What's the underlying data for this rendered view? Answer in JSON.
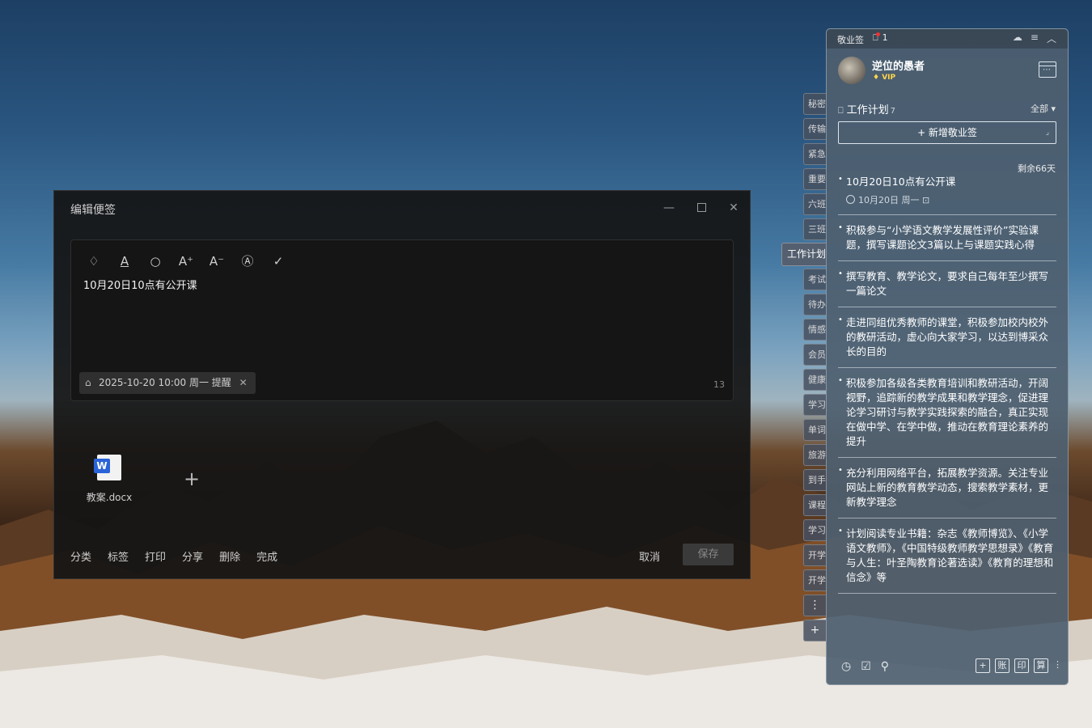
{
  "editor": {
    "title": "编辑便签",
    "win_min": "—",
    "win_close": "✕",
    "toolbar": [
      "bell-icon",
      "text-color-icon",
      "search-icon",
      "font-increase-icon",
      "font-decrease-icon",
      "auto-format-icon",
      "check-icon"
    ],
    "toolbar_glyphs": [
      "♢",
      "A",
      "○",
      "A⁺",
      "A⁻",
      "Ⓐ",
      "✓"
    ],
    "content": "10月20日10点有公开课",
    "reminder": "2025-10-20 10:00 周一 提醒",
    "char_count": "13",
    "attachment": {
      "name": "教案.docx",
      "badge": "W"
    },
    "add_symbol": "+",
    "actions": [
      "分类",
      "标签",
      "打印",
      "分享",
      "删除",
      "完成"
    ],
    "cancel": "取消",
    "save": "保存"
  },
  "side_tabs": {
    "items": [
      "秘密",
      "传输",
      "紧急",
      "重要",
      "六班",
      "三班",
      "考试",
      "待办",
      "情感",
      "会员",
      "健康",
      "学习",
      "单词",
      "旅游",
      "到手",
      "课程",
      "学习",
      "开学",
      "开学"
    ],
    "active": "工作计划",
    "more": "⋮",
    "add": "+"
  },
  "panel": {
    "app_name": "敬业签",
    "notification_count": "1",
    "username": "逆位的愚者",
    "vip": "VIP",
    "folder": "工作计划",
    "folder_count": "7",
    "filter": "全部 ▾",
    "new_button": "+ 新增敬业签",
    "remaining": "剩余66天",
    "notes": [
      {
        "text": "10月20日10点有公开课",
        "meta": "10月20日 周一"
      },
      {
        "text": "积极参与“小学语文教学发展性评价”实验课题，撰写课题论文3篇以上与课题实践心得"
      },
      {
        "text": "撰写教育、教学论文，要求自己每年至少撰写一篇论文"
      },
      {
        "text": "走进同组优秀教师的课堂，积极参加校内校外的教研活动，虚心向大家学习，以达到博采众长的目的"
      },
      {
        "text": "积极参加各级各类教育培训和教研活动，开阔视野，追踪新的教学成果和教学理念，促进理论学习研讨与教学实践探索的融合，真正实现在做中学、在学中做，推动在教育理论素养的提升"
      },
      {
        "text": "充分利用网络平台，拓展教学资源。关注专业网站上新的教育教学动态，搜索教学素材，更新教学理念"
      },
      {
        "text": "计划阅读专业书籍：杂志《教师博览》、《小学语文教师》，《中国特级教师教学思想录》《教育与人生：叶圣陶教育论著选读》《教育的理想和信念》等"
      }
    ],
    "footer_right": [
      "+",
      "账",
      "印",
      "算"
    ]
  }
}
